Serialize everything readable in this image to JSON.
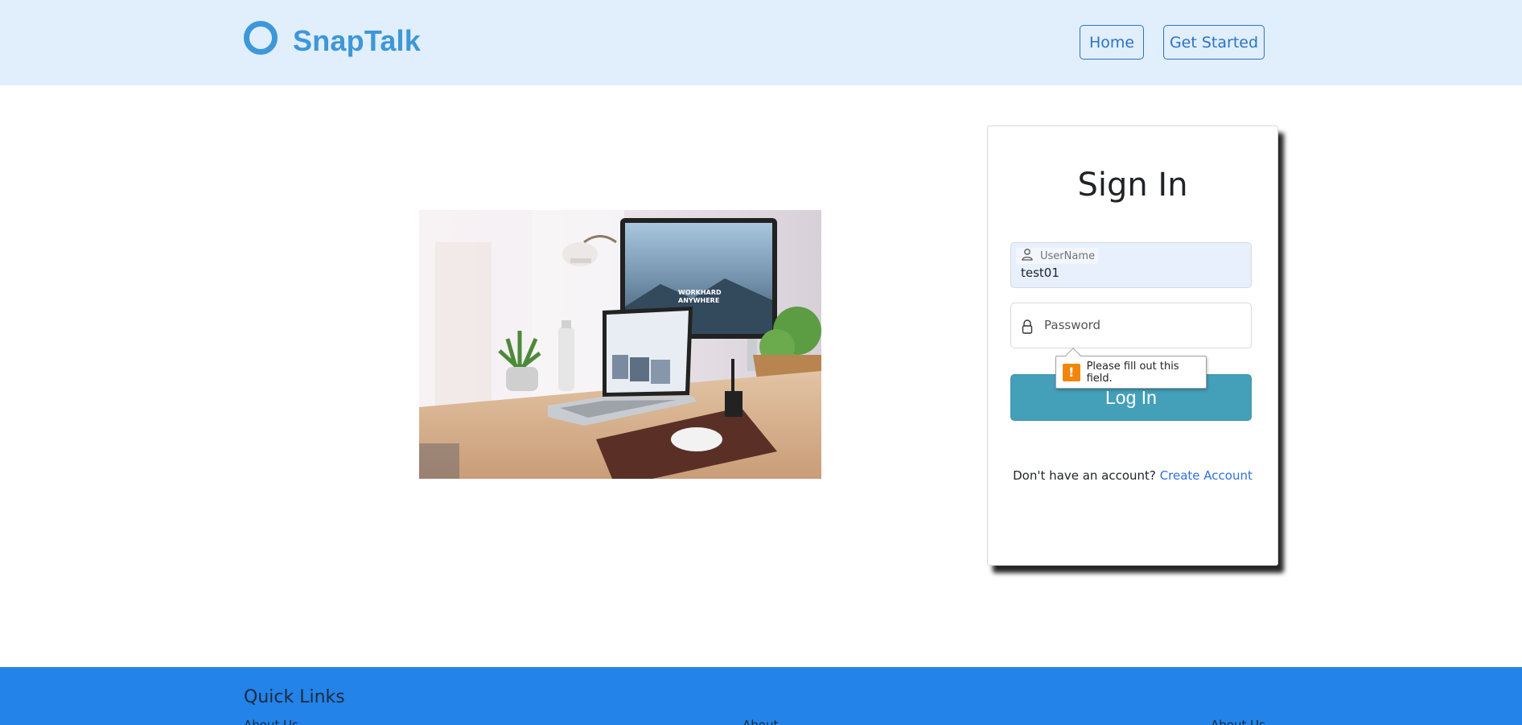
{
  "header": {
    "brand": "SnapTalk",
    "nav": {
      "home": "Home",
      "get_started": "Get Started"
    }
  },
  "hero": {
    "alt": "Workspace desk with laptop and monitor"
  },
  "signin": {
    "title": "Sign In",
    "username": {
      "label": "UserName",
      "value": "test01"
    },
    "password": {
      "placeholder": "Password"
    },
    "validation": "Please fill out this field.",
    "login_button": "Log In",
    "signup_prompt": "Don't have an account?",
    "signup_link": "Create Account"
  },
  "footer": {
    "title": "Quick Links",
    "links": [
      "About Us",
      "About",
      "About Us"
    ]
  },
  "colors": {
    "header_bg": "#e1eefb",
    "brand": "#3d97d9",
    "nav": "#2b74c2",
    "login_button": "#449fb9",
    "link": "#2f6fdb",
    "footer_bg": "#2383e8",
    "warning": "#f0860c"
  },
  "icons": [
    "brand-ring-icon",
    "user-icon",
    "lock-icon",
    "warning-icon"
  ]
}
